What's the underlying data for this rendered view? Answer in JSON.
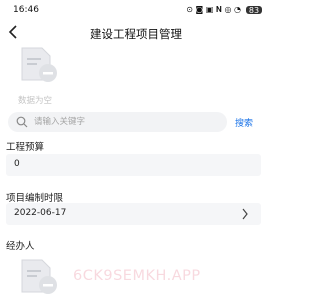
{
  "status_bar": {
    "time": "16:46",
    "icons_text": "⊙ ◙ ▣ 𝐍 ◎ ◔",
    "battery": "83"
  },
  "nav": {
    "title": "建设工程项目管理"
  },
  "empty_state": {
    "text": "数据为空"
  },
  "search": {
    "placeholder": "请输入关键字",
    "value": "",
    "button_label": "搜索"
  },
  "form": {
    "budget": {
      "label": "工程预算",
      "value": "0"
    },
    "deadline": {
      "label": "项目编制时限",
      "value": "2022-06-17"
    },
    "handler": {
      "label": "经办人"
    }
  },
  "watermark": "6CK9SEMKH.APP",
  "colors": {
    "accent": "#1a73e8",
    "field_bg": "#f5f6f8",
    "muted": "#c4c4c4"
  }
}
